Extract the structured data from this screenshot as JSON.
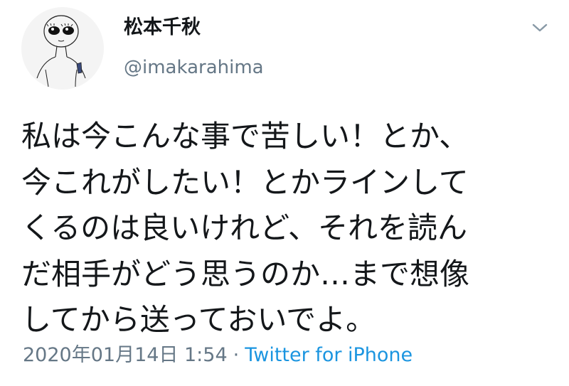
{
  "user": {
    "display_name": "松本千秋",
    "handle": "@imakarahima"
  },
  "menu": {
    "icon": "chevron-down-icon"
  },
  "tweet": {
    "lines": [
      "私は今こんな事で苦しい！とか、",
      "今これがしたい！とかラインして",
      "くるのは良いけれど、それを読ん",
      "だ相手がどう思うのか…まで想像",
      "してから送っておいでよ。"
    ]
  },
  "meta": {
    "timestamp": "2020年01月14日 1:54",
    "separator": "·",
    "source": "Twitter for iPhone"
  },
  "colors": {
    "text": "#14171a",
    "secondary": "#657786",
    "link": "#1b95e0"
  }
}
